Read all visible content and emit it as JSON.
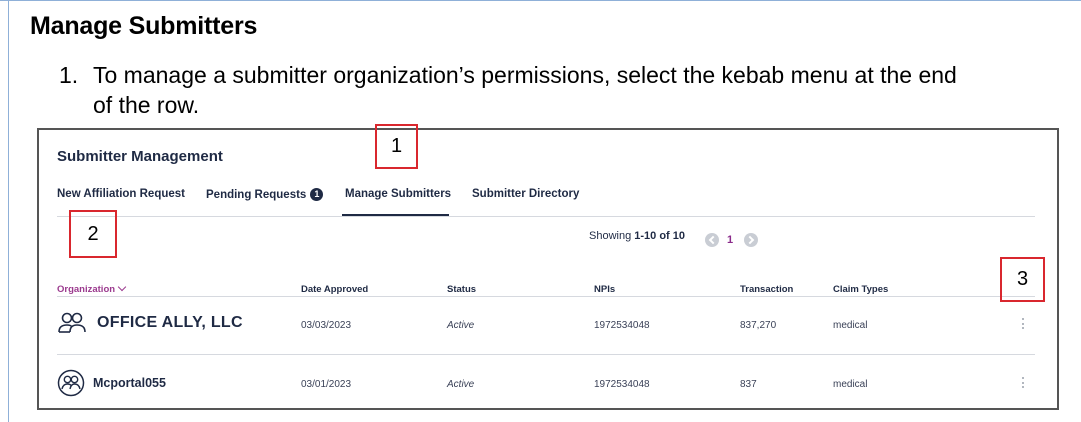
{
  "doc": {
    "heading": "Manage Submitters",
    "step_number": "1.",
    "step_line1": "To manage a submitter organization’s permissions, select the kebab menu at the end",
    "step_line2": "of the row."
  },
  "app": {
    "title": "Submitter Management",
    "tabs": [
      {
        "label": "New Affiliation Request"
      },
      {
        "label": "Pending Requests",
        "badge": "1"
      },
      {
        "label": "Manage Submitters",
        "active": true
      },
      {
        "label": "Submitter Directory"
      }
    ],
    "pager": {
      "prefix": "Showing ",
      "range": "1-10 of 10",
      "page": "1"
    },
    "columns": {
      "organization": "Organization",
      "date_approved": "Date Approved",
      "status": "Status",
      "npis": "NPIs",
      "transaction": "Transaction",
      "claim_types": "Claim Types"
    },
    "rows": [
      {
        "organization": "OFFICE ALLY, LLC",
        "date_approved": "03/03/2023",
        "status": "Active",
        "npis": "1972534048",
        "transaction": "837,270",
        "claim_types": "medical"
      },
      {
        "organization": "Mcportal055",
        "date_approved": "03/01/2023",
        "status": "Active",
        "npis": "1972534048",
        "transaction": "837",
        "claim_types": "medical"
      }
    ],
    "icons": {
      "organization": "user-group-icon",
      "row_menu": "kebab-menu-icon",
      "prev": "chevron-left-icon",
      "next": "chevron-right-icon"
    }
  },
  "callouts": [
    {
      "label": "1"
    },
    {
      "label": "2"
    },
    {
      "label": "3"
    }
  ],
  "colors": {
    "accent": "#1f2a44",
    "org_header": "#9b3a8e",
    "callout": "#d9272e"
  }
}
